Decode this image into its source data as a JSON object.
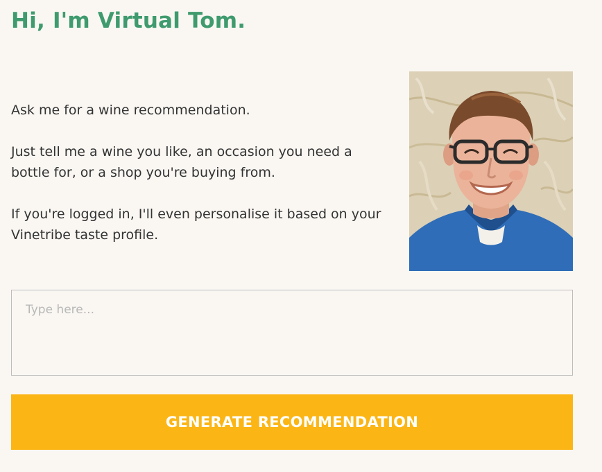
{
  "header": {
    "title": "Hi, I'm Virtual Tom."
  },
  "intro": {
    "paragraph_1": "Ask me for a wine recommendation.",
    "paragraph_2": "Just tell me a wine you like, an occasion you need a bottle for, or a shop you're buying from.",
    "paragraph_3": "If you're logged in, I'll even personalise it based on your Vinetribe taste profile."
  },
  "portrait": {
    "icon": "tom-portrait-illustration"
  },
  "input": {
    "value": "",
    "placeholder": "Type here..."
  },
  "actions": {
    "generate_label": "GENERATE RECOMMENDATION"
  },
  "colors": {
    "title": "#3f9b6e",
    "button": "#fbb616",
    "background": "#faf7f3"
  }
}
